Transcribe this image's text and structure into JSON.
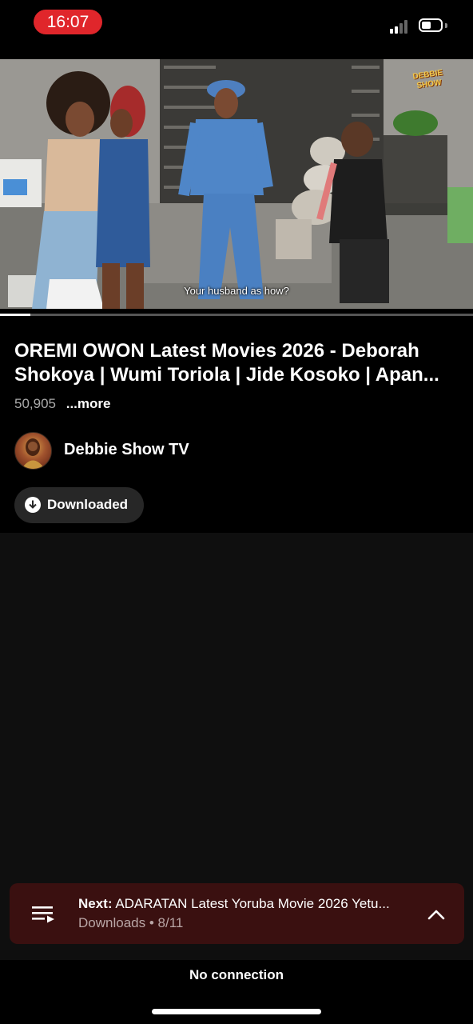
{
  "status_bar": {
    "time": "16:07"
  },
  "video": {
    "subtitle": "Your husband as how?",
    "watermark": "DEBBIE SHOW",
    "progress": 0.065
  },
  "video_info": {
    "title_line1": "OREMI OWON Latest Movies 2026 - Deborah",
    "title_line2": "Shokoya | Wumi Toriola | Jide Kosoko | Apan...",
    "views": "50,905",
    "more_label": "...more"
  },
  "channel": {
    "name": "Debbie Show TV"
  },
  "download_chip": {
    "label": "Downloaded"
  },
  "next_bar": {
    "prefix": "Next:",
    "title": "ADARATAN Latest Yoruba Movie 2026 Yetu...",
    "playlist": "Downloads",
    "position": "8/11"
  },
  "footer": {
    "status": "No connection"
  },
  "colors": {
    "time_pill": "#e0262b",
    "next_bar_bg": "#3a1010"
  }
}
